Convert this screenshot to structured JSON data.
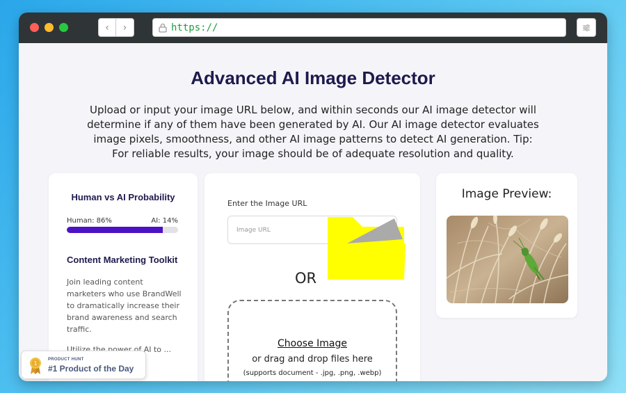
{
  "browser": {
    "back_glyph": "‹",
    "forward_glyph": "›",
    "url": "https://"
  },
  "page": {
    "title": "Advanced AI Image Detector",
    "description": "Upload or input your image URL below, and within seconds our AI image detector will determine if any of them have been generated by AI. Our AI image detector evaluates image pixels, smoothness, and other AI image patterns to detect AI generation. Tip: For reliable results, your image should be of adequate resolution and quality."
  },
  "probability": {
    "title": "Human vs AI Probability",
    "human_label": "Human: 86%",
    "ai_label": "AI: 14%",
    "human_percent": 86,
    "fill_color": "#4c12c4"
  },
  "toolkit": {
    "title": "Content Marketing Toolkit",
    "paragraph1": "Join leading content marketers who use BrandWell to dramatically increase their brand awareness and search traffic.",
    "paragraph2": "Utilize the power of AI to ... og posts ... , backed"
  },
  "upload": {
    "url_label": "Enter the Image URL",
    "url_placeholder": "Image URL",
    "or_text": "OR",
    "choose_label": "Choose Image",
    "drag_text": "or drag and drop files here",
    "supports_text": "(supports document - .jpg, .png, .webp)",
    "folder_icon": "folder-icon"
  },
  "preview": {
    "title": "Image Preview:",
    "image": "grasshopper-on-wheat-photo"
  },
  "product_hunt": {
    "small": "PRODUCT HUNT",
    "big": "#1 Product of the Day",
    "icon": "medal-icon"
  }
}
